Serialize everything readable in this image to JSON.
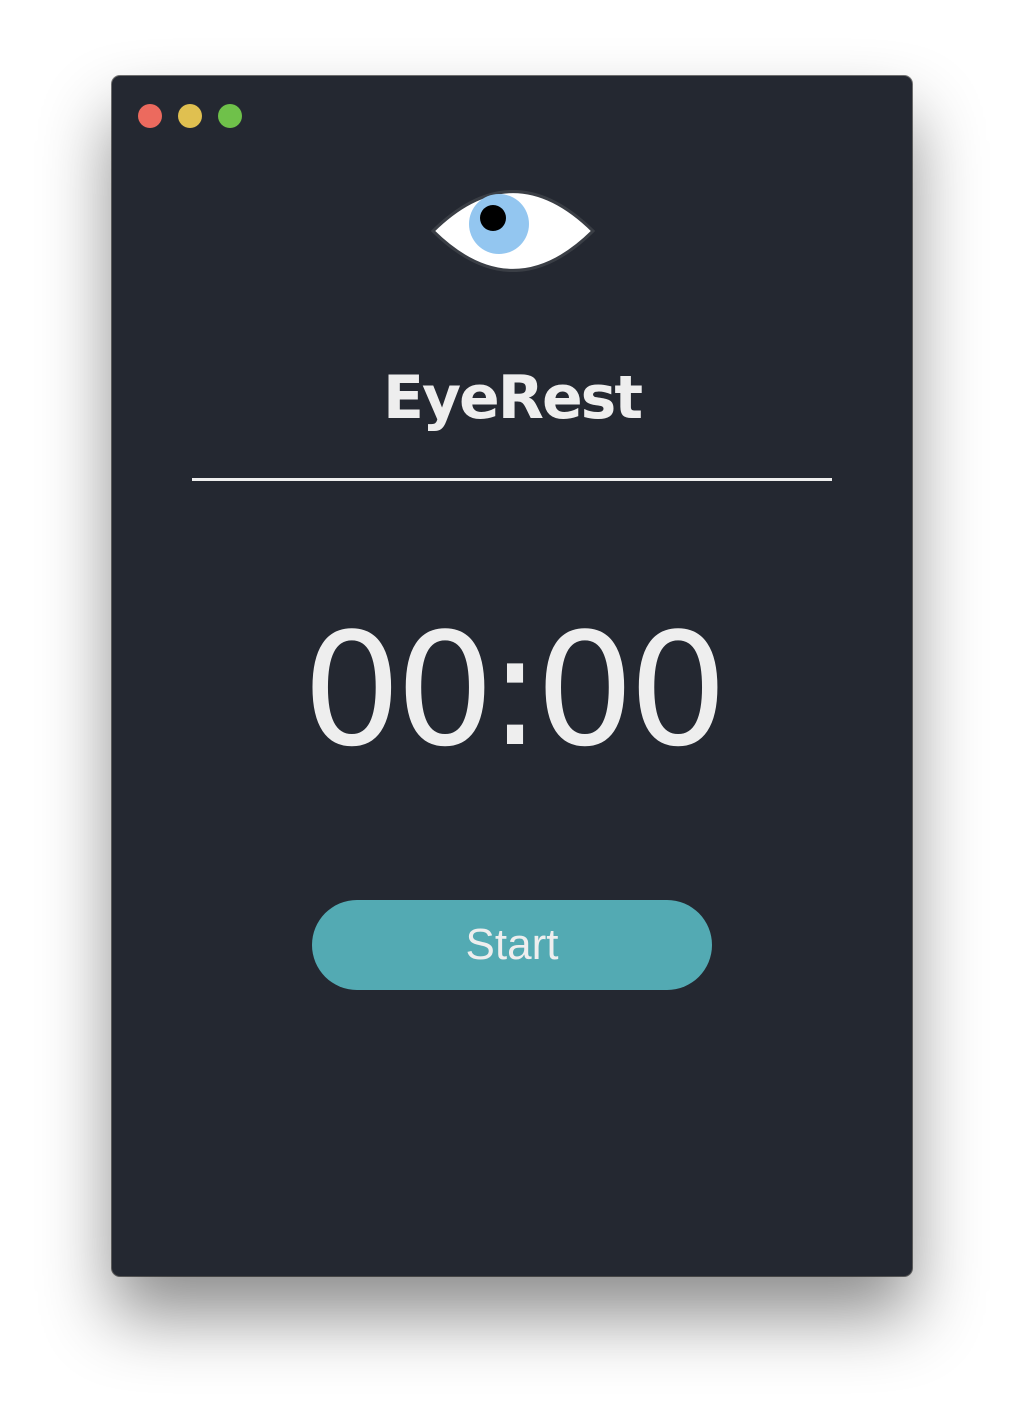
{
  "window": {
    "controls": [
      {
        "name": "close",
        "color": "#ec6a5e"
      },
      {
        "name": "minimize",
        "color": "#e0c050"
      },
      {
        "name": "zoom",
        "color": "#6fc14a"
      }
    ]
  },
  "app": {
    "logo_icon": "eye-icon",
    "title": "EyeRest"
  },
  "timer": {
    "display": "00:00"
  },
  "actions": {
    "start_label": "Start"
  },
  "colors": {
    "background": "#242831",
    "text": "#eeeeee",
    "accent": "#53aab3",
    "iris": "#93c6f0"
  }
}
